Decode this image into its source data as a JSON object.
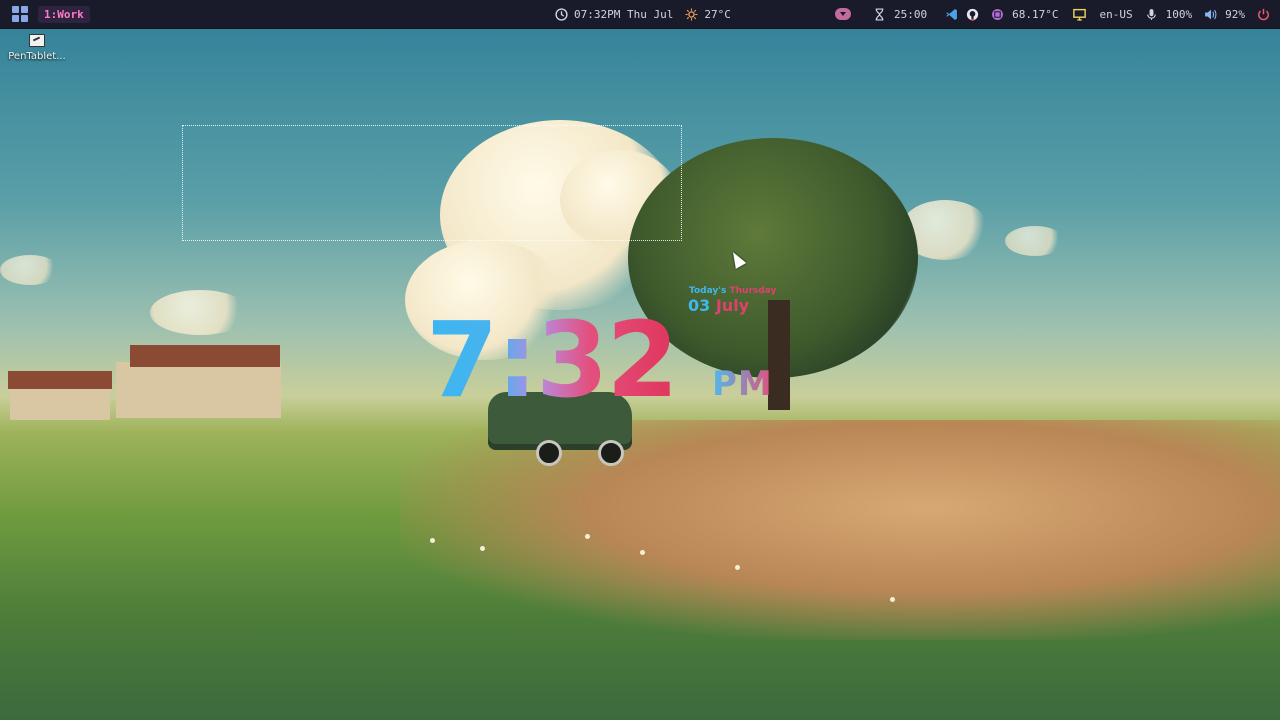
{
  "topbar": {
    "workspace": "1:Work",
    "clock_text": "07:32PM Thu Jul",
    "weather_temp": "27°C",
    "timer": "25:00",
    "cpu_temp": "68.17°C",
    "keyboard_layout": "en-US",
    "mic_level": "100%",
    "volume": "92%"
  },
  "desktop": {
    "icons": [
      {
        "label": "PenTablet..."
      }
    ]
  },
  "clock_widget": {
    "time": "7:32",
    "ampm": "PM",
    "today_prefix": "Today's ",
    "weekday": "Thursday",
    "day": "03 ",
    "month": "July"
  },
  "colors": {
    "bar_bg": "#1a1b2a",
    "workspace_fg": "#ff7ac6",
    "clock_blue": "#3fb8ee",
    "clock_red": "#e0355c"
  }
}
